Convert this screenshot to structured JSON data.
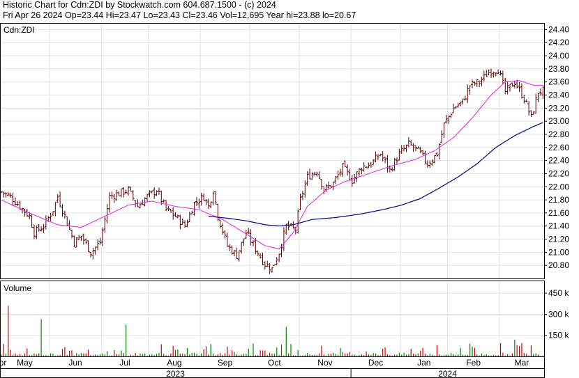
{
  "header": {
    "line1": "Historic Chart for Cdn:ZDI by Stockwatch.com 604.687.1500 - (c) 2024",
    "line2": "Fri Apr 26 2024   Op=23.44  Hi=23.47  Lo=23.43  Cl=23.46  Vol=12,695  Year hi=23.88  lo=20.67"
  },
  "chart_data": {
    "type": "bar",
    "symbol_label": "Cdn:ZDI",
    "volume_label": "Volume",
    "price_axis": {
      "ylim": [
        20.6,
        24.5
      ],
      "ticks": [
        "20.80",
        "21.00",
        "21.20",
        "21.40",
        "21.60",
        "21.80",
        "22.00",
        "22.20",
        "22.40",
        "22.60",
        "22.80",
        "23.00",
        "23.20",
        "23.40",
        "23.60",
        "23.80",
        "24.00",
        "24.20",
        "24.40"
      ],
      "grid": true
    },
    "volume_axis": {
      "ylim": [
        0,
        540000
      ],
      "ticks": [
        {
          "label": "150 k",
          "value": 150000
        },
        {
          "label": "300 k",
          "value": 300000
        },
        {
          "label": "450 k",
          "value": 450000
        }
      ]
    },
    "months": [
      "May",
      "Jun",
      "Jul",
      "Aug",
      "Sep",
      "Oct",
      "Nov",
      "Dec",
      "Jan",
      "Feb",
      "Mar",
      "Apr"
    ],
    "years": [
      "2023",
      "2024"
    ],
    "price_anchors": [
      [
        0,
        21.92
      ],
      [
        4,
        21.85
      ],
      [
        8,
        21.7
      ],
      [
        12,
        21.55
      ],
      [
        14,
        21.3
      ],
      [
        18,
        21.4
      ],
      [
        22,
        21.65
      ],
      [
        24,
        21.85
      ],
      [
        28,
        21.45
      ],
      [
        31,
        21.15
      ],
      [
        34,
        21.25
      ],
      [
        38,
        21.0
      ],
      [
        42,
        21.15
      ],
      [
        46,
        21.85
      ],
      [
        50,
        21.9
      ],
      [
        54,
        21.95
      ],
      [
        58,
        21.7
      ],
      [
        62,
        21.85
      ],
      [
        66,
        21.95
      ],
      [
        70,
        21.65
      ],
      [
        74,
        21.55
      ],
      [
        78,
        21.4
      ],
      [
        82,
        21.75
      ],
      [
        86,
        21.85
      ],
      [
        88,
        21.7
      ],
      [
        90,
        21.95
      ],
      [
        92,
        21.55
      ],
      [
        96,
        21.1
      ],
      [
        100,
        20.95
      ],
      [
        104,
        21.3
      ],
      [
        108,
        21.05
      ],
      [
        112,
        20.82
      ],
      [
        115,
        20.75
      ],
      [
        118,
        21.0
      ],
      [
        121,
        21.4
      ],
      [
        125,
        21.35
      ],
      [
        127,
        21.8
      ],
      [
        130,
        22.15
      ],
      [
        134,
        22.25
      ],
      [
        137,
        21.95
      ],
      [
        141,
        22.05
      ],
      [
        145,
        22.3
      ],
      [
        149,
        22.1
      ],
      [
        153,
        22.3
      ],
      [
        157,
        22.35
      ],
      [
        161,
        22.5
      ],
      [
        165,
        22.25
      ],
      [
        169,
        22.5
      ],
      [
        173,
        22.65
      ],
      [
        177,
        22.55
      ],
      [
        181,
        22.35
      ],
      [
        185,
        22.5
      ],
      [
        188,
        22.95
      ],
      [
        192,
        23.2
      ],
      [
        196,
        23.3
      ],
      [
        199,
        23.55
      ],
      [
        203,
        23.6
      ],
      [
        207,
        23.75
      ],
      [
        211,
        23.8
      ],
      [
        214,
        23.45
      ],
      [
        218,
        23.6
      ],
      [
        222,
        23.35
      ],
      [
        225,
        23.05
      ],
      [
        228,
        23.45
      ],
      [
        230,
        23.46
      ]
    ],
    "ma_short": [
      [
        0,
        21.8
      ],
      [
        12,
        21.6
      ],
      [
        24,
        21.42
      ],
      [
        34,
        21.38
      ],
      [
        44,
        21.55
      ],
      [
        54,
        21.72
      ],
      [
        64,
        21.78
      ],
      [
        74,
        21.7
      ],
      [
        84,
        21.65
      ],
      [
        94,
        21.5
      ],
      [
        104,
        21.28
      ],
      [
        112,
        21.1
      ],
      [
        118,
        21.05
      ],
      [
        124,
        21.3
      ],
      [
        130,
        21.7
      ],
      [
        138,
        21.95
      ],
      [
        146,
        22.08
      ],
      [
        156,
        22.2
      ],
      [
        166,
        22.32
      ],
      [
        176,
        22.42
      ],
      [
        184,
        22.55
      ],
      [
        192,
        22.75
      ],
      [
        200,
        23.05
      ],
      [
        208,
        23.4
      ],
      [
        214,
        23.6
      ],
      [
        220,
        23.62
      ],
      [
        226,
        23.55
      ],
      [
        230,
        23.55
      ]
    ],
    "ma_long": [
      [
        88,
        21.55
      ],
      [
        96,
        21.52
      ],
      [
        104,
        21.48
      ],
      [
        112,
        21.42
      ],
      [
        118,
        21.4
      ],
      [
        124,
        21.42
      ],
      [
        132,
        21.5
      ],
      [
        142,
        21.53
      ],
      [
        152,
        21.58
      ],
      [
        162,
        21.65
      ],
      [
        170,
        21.72
      ],
      [
        178,
        21.82
      ],
      [
        186,
        21.98
      ],
      [
        194,
        22.15
      ],
      [
        202,
        22.35
      ],
      [
        210,
        22.6
      ],
      [
        218,
        22.78
      ],
      [
        226,
        22.92
      ],
      [
        230,
        22.98
      ]
    ],
    "colors": {
      "up": "#008000",
      "down": "#cc0000",
      "price_bar": "#5a0000",
      "ma_short": "#e020e0",
      "ma_long": "#000080",
      "grid": "#e0e0e0",
      "border": "#000000"
    }
  }
}
